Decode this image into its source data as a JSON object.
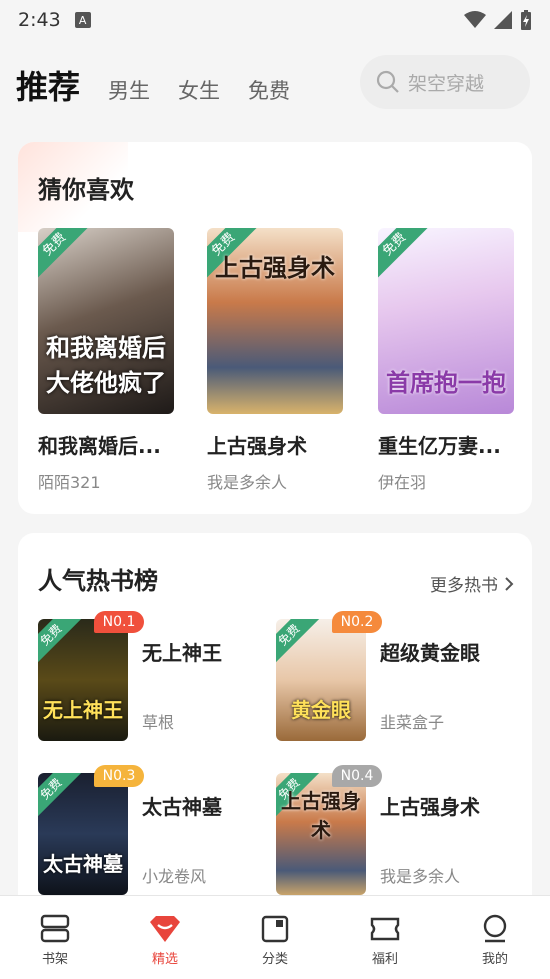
{
  "status": {
    "time": "2:43",
    "notif_letter": "A"
  },
  "nav": {
    "tabs": [
      {
        "label": "推荐",
        "active": true
      },
      {
        "label": "男生",
        "active": false
      },
      {
        "label": "女生",
        "active": false
      },
      {
        "label": "免费",
        "active": false
      }
    ],
    "search_placeholder": "架空穿越"
  },
  "guess": {
    "title": "猜你喜欢",
    "free_label": "免费",
    "books": [
      {
        "title": "和我离婚后...",
        "author": "陌陌321",
        "cover_text": "和我离婚后大佬他疯了"
      },
      {
        "title": "上古强身术",
        "author": "我是多余人",
        "cover_text": "上古强身术"
      },
      {
        "title": "重生亿万妻...",
        "author": "伊在羽",
        "cover_text": "首席抱一抱"
      }
    ]
  },
  "rank": {
    "title": "人气热书榜",
    "more_label": "更多热书",
    "free_label": "免费",
    "items": [
      {
        "badge": "N0.1",
        "title": "无上神王",
        "author": "草根",
        "cover_text": "无上神王",
        "badge_color": "#f0503c"
      },
      {
        "badge": "N0.2",
        "title": "超级黄金眼",
        "author": "韭菜盒子",
        "cover_text": "黄金眼",
        "badge_color": "#f58a3c"
      },
      {
        "badge": "N0.3",
        "title": "太古神墓",
        "author": "小龙卷风",
        "cover_text": "太古神墓",
        "badge_color": "#f5b43c"
      },
      {
        "badge": "N0.4",
        "title": "上古强身术",
        "author": "我是多余人",
        "cover_text": "上古强身术",
        "badge_color": "#a8a8a8"
      }
    ]
  },
  "tabbar": {
    "items": [
      {
        "label": "书架",
        "icon": "bookshelf-icon",
        "active": false
      },
      {
        "label": "精选",
        "icon": "diamond-icon",
        "active": true
      },
      {
        "label": "分类",
        "icon": "category-icon",
        "active": false
      },
      {
        "label": "福利",
        "icon": "ticket-icon",
        "active": false
      },
      {
        "label": "我的",
        "icon": "profile-icon",
        "active": false
      }
    ]
  },
  "colors": {
    "accent": "#e8453c",
    "free_green": "#3aa676"
  }
}
